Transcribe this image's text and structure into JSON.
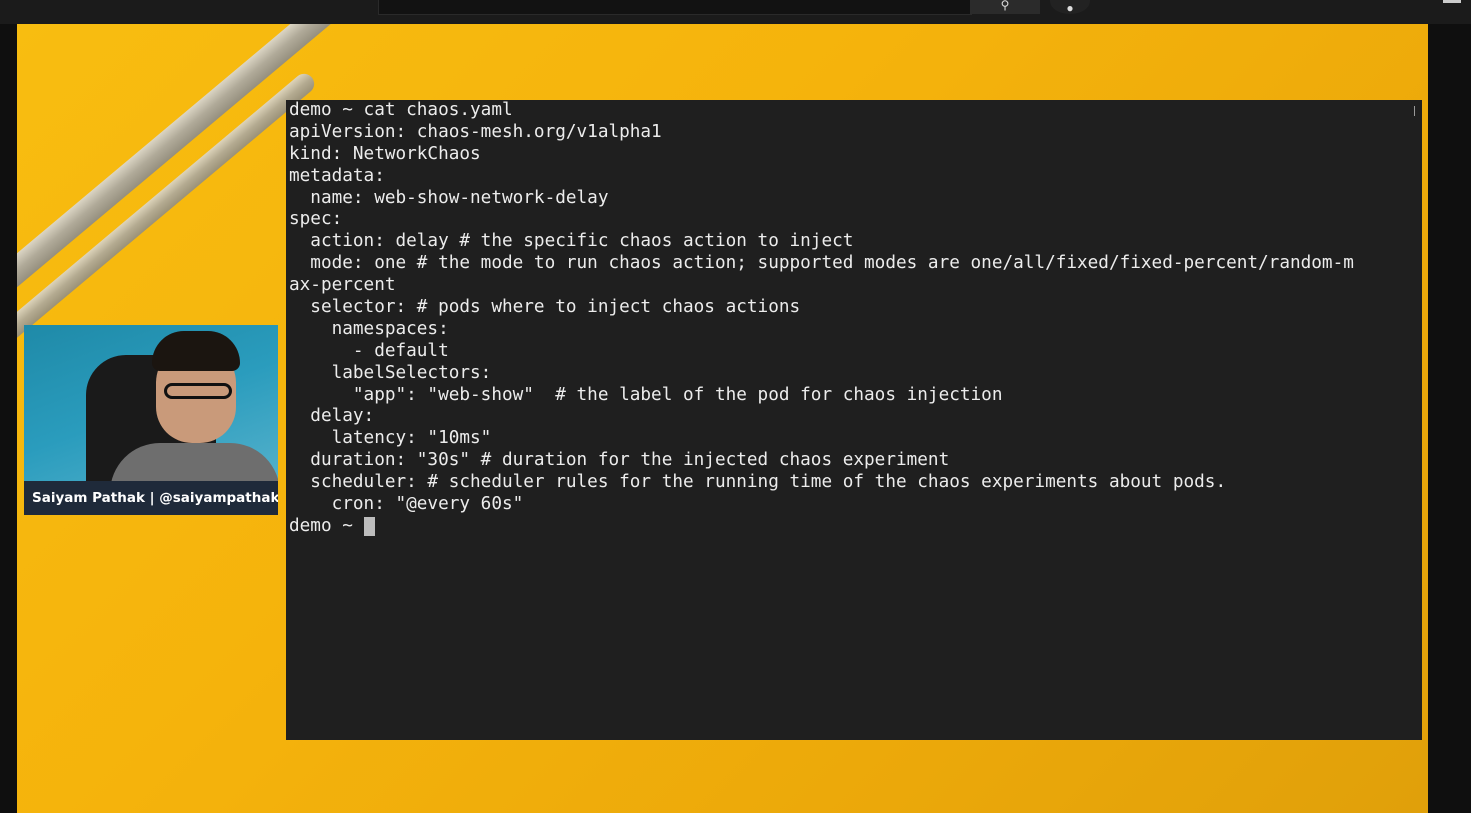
{
  "top_bar": {
    "search_icon": "search-icon",
    "mic_icon": "mic-icon",
    "menu_icon": "menu-icon"
  },
  "terminal": {
    "lines": [
      "demo ~ cat chaos.yaml",
      "apiVersion: chaos-mesh.org/v1alpha1",
      "kind: NetworkChaos",
      "metadata:",
      "  name: web-show-network-delay",
      "spec:",
      "  action: delay # the specific chaos action to inject",
      "  mode: one # the mode to run chaos action; supported modes are one/all/fixed/fixed-percent/random-m",
      "ax-percent",
      "  selector: # pods where to inject chaos actions",
      "    namespaces:",
      "      - default",
      "    labelSelectors:",
      "      \"app\": \"web-show\"  # the label of the pod for chaos injection",
      "  delay:",
      "    latency: \"10ms\"",
      "  duration: \"30s\" # duration for the injected chaos experiment",
      "  scheduler: # scheduler rules for the running time of the chaos experiments about pods.",
      "    cron: \"@every 60s\""
    ],
    "prompt": "demo ~ "
  },
  "webcam": {
    "name_label": "Saiyam Pathak | @saiyampathak"
  }
}
